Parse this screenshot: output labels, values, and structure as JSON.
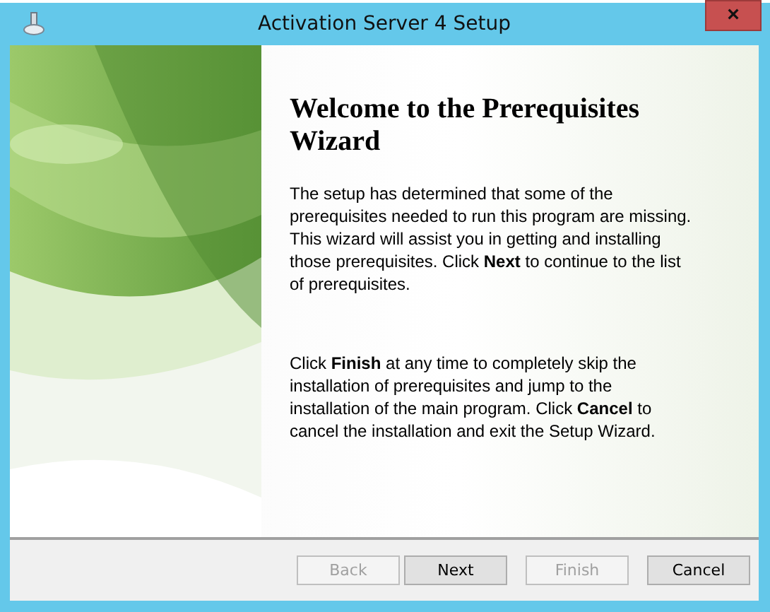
{
  "window": {
    "title": "Activation Server 4 Setup",
    "close": "×"
  },
  "heading": "Welcome to the Prerequisites Wizard",
  "paragraphs": [
    "The setup has determined that some of the prerequisites needed to run this program are missing. This wizard will assist you in getting and installing those prerequisites. Click **Next**  to continue to the list of prerequisites.",
    "Click **Finish** at any time to completely skip the installation of prerequisites and jump to the installation of the main program. Click **Cancel** to cancel the installation and exit the Setup Wizard."
  ],
  "buttons": [
    {
      "label": "Back",
      "disabled": true
    },
    {
      "label": "Next",
      "disabled": false
    },
    {
      "label": "Finish",
      "disabled": true
    },
    {
      "label": "Cancel",
      "disabled": false
    }
  ]
}
